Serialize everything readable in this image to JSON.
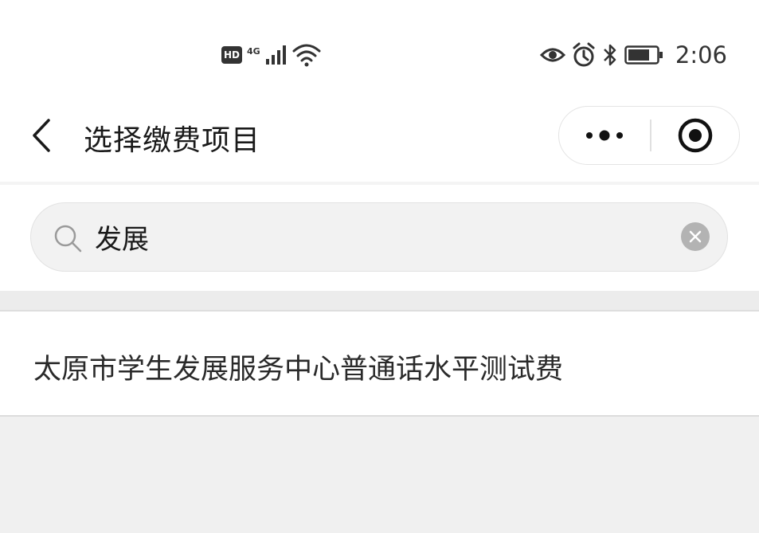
{
  "status_bar": {
    "hd_label": "HD",
    "network_label": "4G",
    "icons": [
      "hd-icon",
      "signal-icon",
      "wifi-icon",
      "eye-icon",
      "alarm-icon",
      "bluetooth-icon",
      "battery-icon"
    ],
    "time": "2:06"
  },
  "title_bar": {
    "title": "选择缴费项目",
    "back_icon": "chevron-left-icon",
    "more_icon": "more-icon",
    "close_icon": "target-icon"
  },
  "search": {
    "value": "发展",
    "icon": "search-icon",
    "clear_icon": "clear-icon"
  },
  "results": [
    {
      "label": "太原市学生发展服务中心普通话水平测试费"
    }
  ],
  "colors": {
    "background": "#f0f0f0",
    "surface": "#ffffff",
    "search_fill": "#f2f2f2",
    "text": "#222222",
    "clear_button": "#b3b3b3"
  }
}
